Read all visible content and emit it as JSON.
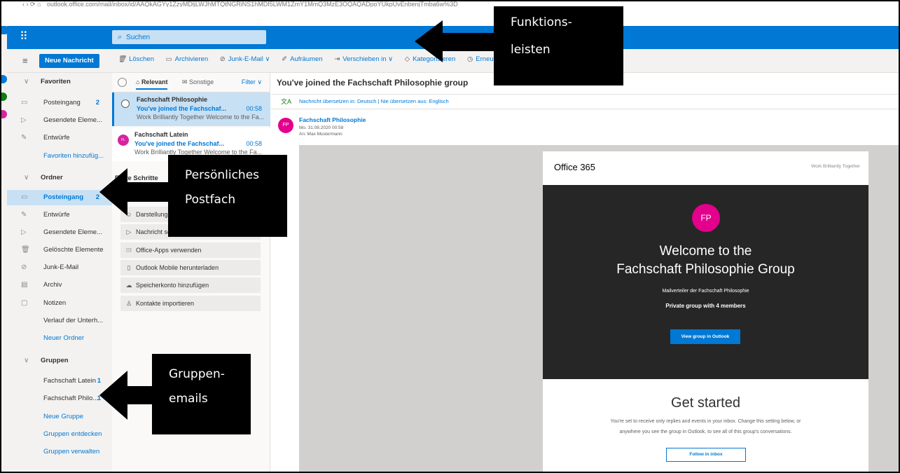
{
  "browser": {
    "url": "outlook.office.com/mail/inbox/id/AAQkAGYy1ZzyMDljLWJhMTQtNGRiNS1hMDI5LWM1ZmY1MmQ3MzE3OQAQADpoYUkpUvEnbenjTmba6w%3D"
  },
  "header": {
    "waffle": "⠿",
    "search_placeholder": "Suchen"
  },
  "toolbar": {
    "new_message": "Neue Nachricht",
    "commands": [
      {
        "label": "Löschen",
        "icon": "🗑"
      },
      {
        "label": "Archivieren",
        "icon": "▭"
      },
      {
        "label": "Junk-E-Mail ∨",
        "icon": "⊘"
      },
      {
        "label": "Aufräumen",
        "icon": "✐"
      },
      {
        "label": "Verschieben in ∨",
        "icon": "⇥"
      },
      {
        "label": "Kategorisieren",
        "icon": "◇"
      },
      {
        "label": "Erneut erin",
        "icon": "◷"
      }
    ]
  },
  "folders": {
    "favorites_header": "Favoriten",
    "favorites": [
      {
        "label": "Posteingang",
        "count": "2",
        "icon": "▭"
      },
      {
        "label": "Gesendete Eleme...",
        "count": "",
        "icon": "▷"
      },
      {
        "label": "Entwürfe",
        "count": "",
        "icon": "✎"
      },
      {
        "label": "Favoriten hinzufüg...",
        "count": "",
        "icon": ""
      }
    ],
    "ordner_header": "Ordner",
    "ordner": [
      {
        "label": "Posteingang",
        "count": "2",
        "icon": "▭"
      },
      {
        "label": "Entwürfe",
        "count": "",
        "icon": "✎"
      },
      {
        "label": "Gesendete Eleme...",
        "count": "",
        "icon": "▷"
      },
      {
        "label": "Gelöschte Elemente",
        "count": "",
        "icon": "🗑"
      },
      {
        "label": "Junk-E-Mail",
        "count": "",
        "icon": "⊘"
      },
      {
        "label": "Archiv",
        "count": "",
        "icon": "▤"
      },
      {
        "label": "Notizen",
        "count": "",
        "icon": "▢"
      },
      {
        "label": "Verlauf der Unterh...",
        "count": "",
        "icon": ""
      },
      {
        "label": "Neuer Ordner",
        "count": "",
        "icon": ""
      }
    ],
    "gruppen_header": "Gruppen",
    "gruppen": [
      {
        "label": "Fachschaft Latein",
        "count": "1"
      },
      {
        "label": "Fachschaft Philo...",
        "count": "1"
      },
      {
        "label": "Neue Gruppe",
        "count": ""
      },
      {
        "label": "Gruppen entdecken",
        "count": ""
      },
      {
        "label": "Gruppen verwalten",
        "count": ""
      }
    ]
  },
  "message_list": {
    "tab_relevant": "Relevant",
    "tab_other": "Sonstige",
    "filter": "Filter ∨",
    "messages": [
      {
        "from": "Fachschaft Philosophie",
        "subject": "You've joined the Fachschaf...",
        "time": "00:58",
        "preview": "Work Brilliantly Together Welcome to the Fa...",
        "initials": ""
      },
      {
        "from": "Fachschaft Latein",
        "subject": "You've joined the Fachschaf...",
        "time": "00:58",
        "preview": "Work Brilliantly Together Welcome to the Fa...",
        "initials": "FL"
      }
    ],
    "getting_started_header": "Erste Schritte",
    "getting_started": [
      {
        "label": "Darstellung anpassen",
        "icon": "☺"
      },
      {
        "label": "Nachricht senden",
        "icon": "▷"
      },
      {
        "label": "Office-Apps verwenden",
        "icon": "⁝⁝⁝"
      },
      {
        "label": "Outlook Mobile herunterladen",
        "icon": "▯"
      },
      {
        "label": "Speicherkonto hinzufügen",
        "icon": "☁"
      },
      {
        "label": "Kontakte importieren",
        "icon": "♙"
      }
    ]
  },
  "reading_pane": {
    "title": "You've joined the Fachschaft Philosophie group",
    "translate_bar": "Nachricht übersetzen in: Deutsch | Nie übersetzen aus: Englisch",
    "sender_initials": "FP",
    "sender": "Fachschaft Philosophie",
    "date": "Mo. 31.08.2020 00:58",
    "to": "An:  Max Mustermann",
    "email": {
      "brand": "Office 365",
      "tagline": "Work Brilliantly Together",
      "avatar_initials": "FP",
      "welcome_line1": "Welcome to the",
      "welcome_line2": "Fachschaft Philosophie Group",
      "description": "Mailverteiler der Fachschaft Philosophie",
      "privacy": "Private group with 4 members",
      "view_button": "View group in Outlook",
      "get_started": "Get started",
      "paragraph1": "You're set to receive only replies and events in your inbox. Change this setting below, or",
      "paragraph2": "anywhere you see the group in Outlook, to see all of this group's conversations.",
      "follow_button": "Follow in inbox"
    }
  },
  "annotations": {
    "funktionsleisten_line1": "Funktions-",
    "funktionsleisten_line2": "leisten",
    "postfach_line1": "Persönliches",
    "postfach_line2": "Postfach",
    "gruppen_line1": "Gruppen-",
    "gruppen_line2": "emails"
  },
  "colors": {
    "accent": "#0078d4",
    "selected": "#c7e0f4",
    "avatar_pink": "#e3008c",
    "annotation": "#000000"
  }
}
